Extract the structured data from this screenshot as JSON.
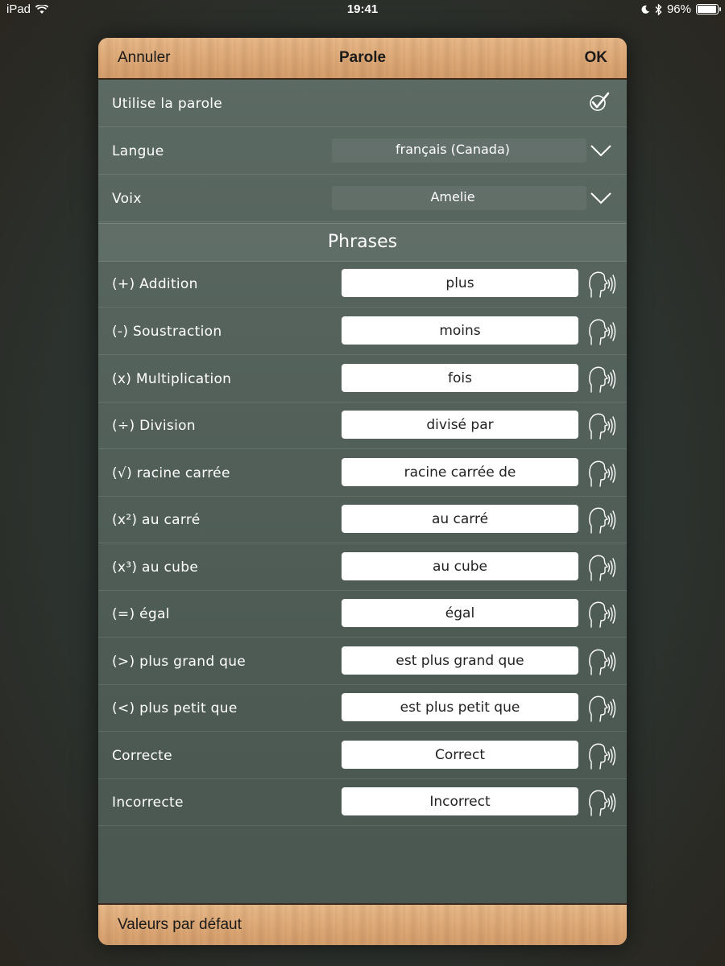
{
  "status_bar": {
    "device": "iPad",
    "time": "19:41",
    "battery": "96%"
  },
  "header": {
    "cancel_label": "Annuler",
    "title": "Parole",
    "ok_label": "OK"
  },
  "settings": {
    "use_speech_label": "Utilise la parole",
    "use_speech_checked": true,
    "language_label": "Langue",
    "language_value": "français (Canada)",
    "voice_label": "Voix",
    "voice_value": "Amelie"
  },
  "phrases_title": "Phrases",
  "phrases": [
    {
      "label": "(+) Addition",
      "value": "plus"
    },
    {
      "label": "(-) Soustraction",
      "value": "moins"
    },
    {
      "label": "(x) Multiplication",
      "value": "fois"
    },
    {
      "label": "(÷) Division",
      "value": "divisé par"
    },
    {
      "label": "(√) racine carrée",
      "value": "racine carrée de"
    },
    {
      "label": "(x²) au carré",
      "value": "au carré"
    },
    {
      "label": "(x³) au cube",
      "value": "au cube"
    },
    {
      "label": "(=) égal",
      "value": "égal"
    },
    {
      "label": "(>) plus grand que",
      "value": "est plus grand que"
    },
    {
      "label": "(<) plus petit que",
      "value": "est plus petit que"
    },
    {
      "label": "Correcte",
      "value": "Correct"
    },
    {
      "label": "Incorrecte",
      "value": "Incorrect"
    }
  ],
  "footer": {
    "defaults_label": "Valeurs par défaut"
  },
  "icons": {
    "checkmark": "checkmark-icon",
    "chevron": "chevron-down-icon",
    "speak": "speaking-head-icon"
  }
}
